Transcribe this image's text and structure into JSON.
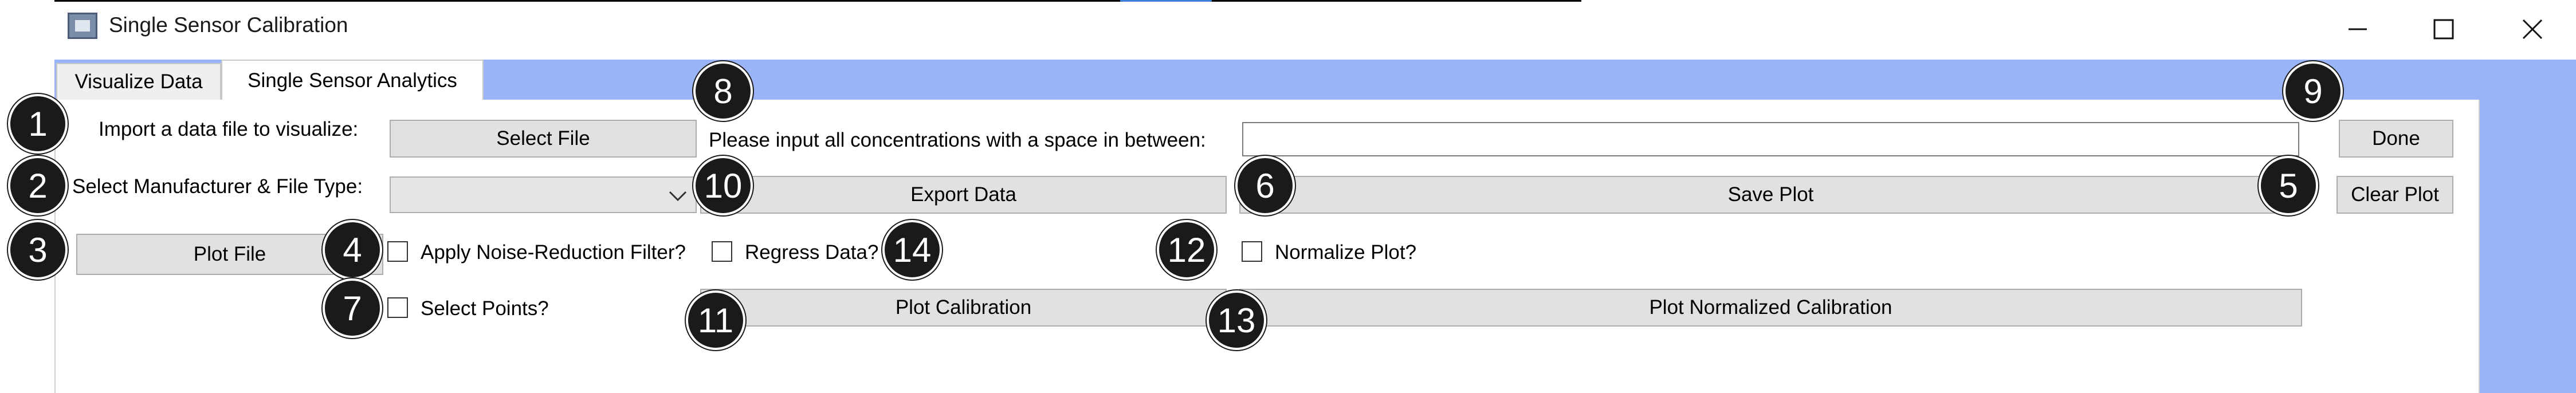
{
  "window": {
    "title": "Single Sensor Calibration",
    "controls": {
      "minimize": "—",
      "maximize": "☐",
      "close": "✕"
    }
  },
  "tabs": [
    {
      "label": "Visualize Data",
      "active": false
    },
    {
      "label": "Single Sensor Analytics",
      "active": true
    }
  ],
  "labels": {
    "import": "Import a data file to visualize:",
    "manufacturer": "Select Manufacturer & File Type:",
    "concentrations": "Please input all concentrations with a space in between:"
  },
  "buttons": {
    "select_file": "Select File",
    "done": "Done",
    "export_data": "Export Data",
    "save_plot": "Save Plot",
    "clear_plot": "Clear Plot",
    "plot_file": "Plot File",
    "plot_calibration": "Plot Calibration",
    "plot_normalized_calibration": "Plot Normalized Calibration"
  },
  "inputs": {
    "concentrations_value": "",
    "manufacturer_selected": ""
  },
  "checkboxes": {
    "noise_reduction": {
      "label": "Apply Noise-Reduction Filter?",
      "checked": false
    },
    "regress": {
      "label": "Regress Data?",
      "checked": false
    },
    "normalize": {
      "label": "Normalize Plot?",
      "checked": false
    },
    "select_points": {
      "label": "Select Points?",
      "checked": false
    }
  },
  "badges": {
    "b1": "1",
    "b2": "2",
    "b3": "3",
    "b4": "4",
    "b5": "5",
    "b6": "6",
    "b7": "7",
    "b8": "8",
    "b9": "9",
    "b10": "10",
    "b11": "11",
    "b12": "12",
    "b13": "13",
    "b14": "14"
  },
  "colors": {
    "accent_blue": "#99b4f7",
    "button_face": "#e1e1e1",
    "badge": "#1a1a1a"
  },
  "icons": {
    "app": "app-window-icon",
    "chevron": "chevron-down-icon"
  }
}
